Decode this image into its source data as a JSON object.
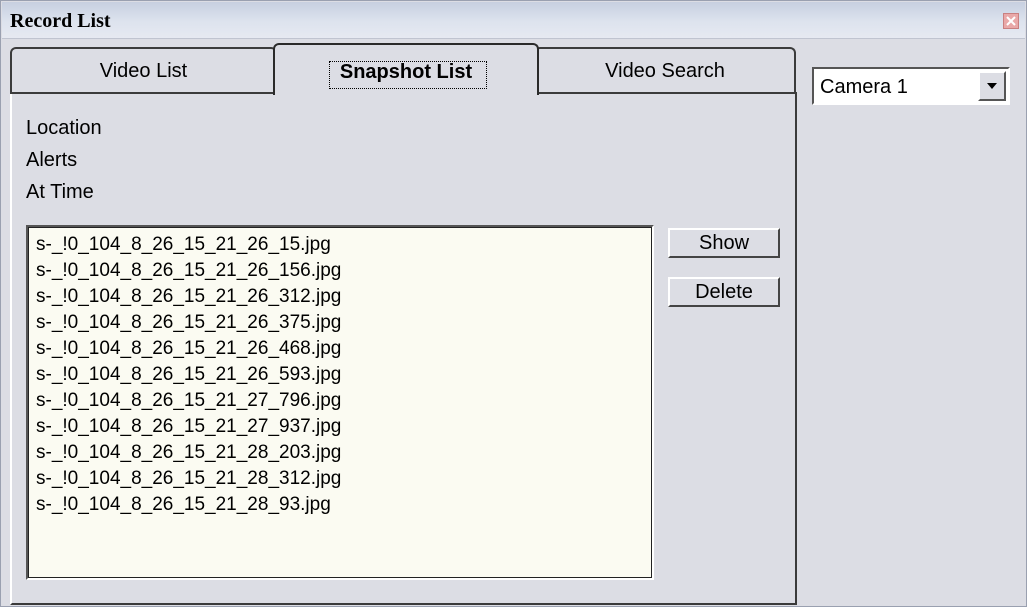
{
  "window": {
    "title": "Record List"
  },
  "tabs": [
    {
      "label": "Video List"
    },
    {
      "label": "Snapshot List"
    },
    {
      "label": "Video Search"
    }
  ],
  "info": {
    "location": "Location",
    "alerts": "Alerts",
    "at_time": "At Time"
  },
  "snapshots": [
    "s-_!0_104_8_26_15_21_26_15.jpg",
    "s-_!0_104_8_26_15_21_26_156.jpg",
    "s-_!0_104_8_26_15_21_26_312.jpg",
    "s-_!0_104_8_26_15_21_26_375.jpg",
    "s-_!0_104_8_26_15_21_26_468.jpg",
    "s-_!0_104_8_26_15_21_26_593.jpg",
    "s-_!0_104_8_26_15_21_27_796.jpg",
    "s-_!0_104_8_26_15_21_27_937.jpg",
    "s-_!0_104_8_26_15_21_28_203.jpg",
    "s-_!0_104_8_26_15_21_28_312.jpg",
    "s-_!0_104_8_26_15_21_28_93.jpg"
  ],
  "buttons": {
    "show": "Show",
    "delete": "Delete"
  },
  "camera_select": {
    "value": "Camera 1"
  },
  "icons": {
    "close": "close-icon",
    "dropdown": "chevron-down-icon"
  },
  "colors": {
    "close_bg": "#e9a8a8",
    "list_bg": "#fbfbf2",
    "window_bg": "#dcdde4"
  }
}
